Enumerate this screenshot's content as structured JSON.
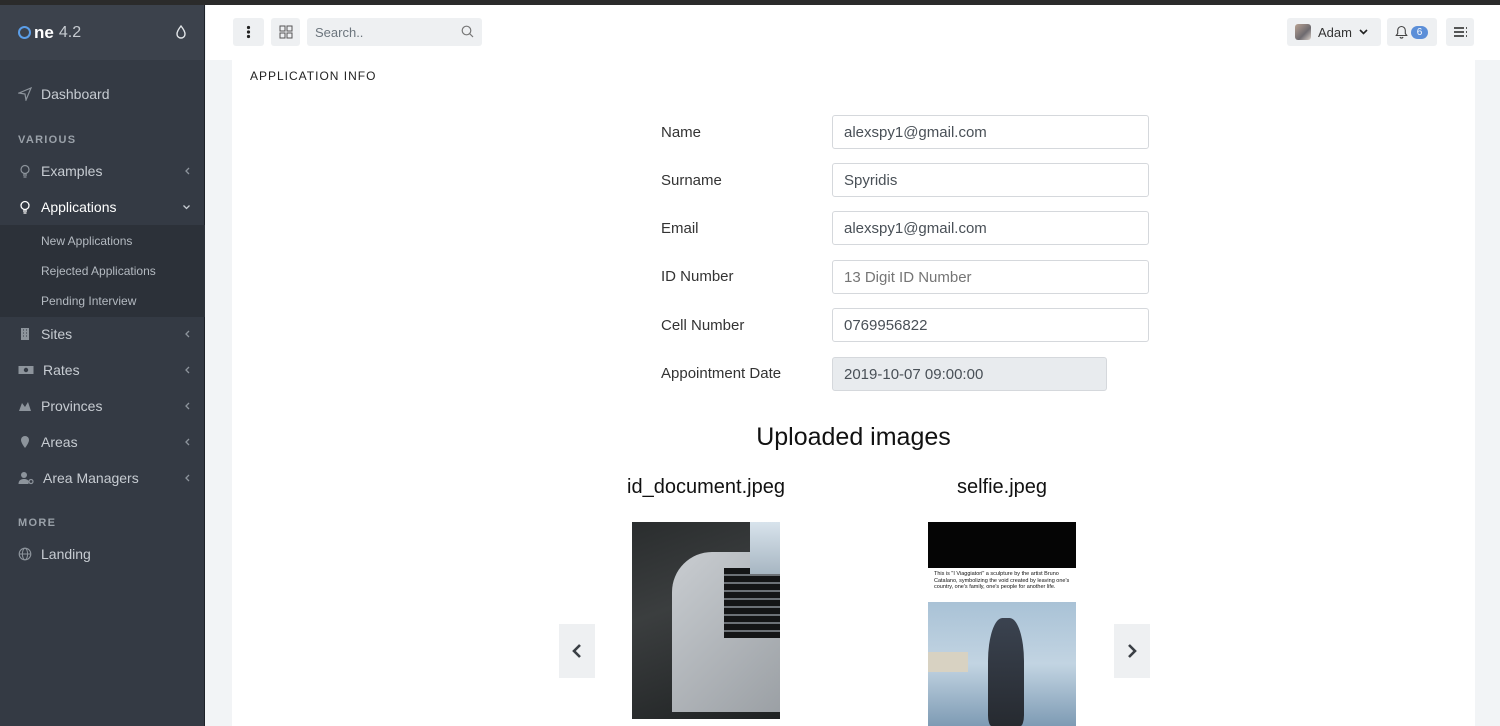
{
  "brand": {
    "name_bold": "ne",
    "version": "4.2"
  },
  "sidebar": {
    "dashboard": "Dashboard",
    "section_various": "VARIOUS",
    "examples": "Examples",
    "applications": "Applications",
    "sub_items": [
      "New Applications",
      "Rejected Applications",
      "Pending Interview"
    ],
    "sites": "Sites",
    "rates": "Rates",
    "provinces": "Provinces",
    "areas": "Areas",
    "area_managers": "Area Managers",
    "section_more": "MORE",
    "landing": "Landing"
  },
  "topbar": {
    "search_placeholder": "Search..",
    "user_name": "Adam",
    "notification_count": "6"
  },
  "card": {
    "title": "APPLICATION INFO",
    "fields": [
      {
        "label": "Name",
        "value": "alexspy1@gmail.com"
      },
      {
        "label": "Surname",
        "value": "Spyridis"
      },
      {
        "label": "Email",
        "value": "alexspy1@gmail.com"
      },
      {
        "label": "ID Number",
        "placeholder": "13 Digit ID Number"
      },
      {
        "label": "Cell Number",
        "value": "0769956822"
      },
      {
        "label": "Appointment Date",
        "value": "2019-10-07 09:00:00"
      }
    ],
    "uploads_heading": "Uploaded images",
    "images": [
      {
        "filename": "id_document.jpeg"
      },
      {
        "filename": "selfie.jpeg",
        "caption": "This is \"I Viaggiatori\" a sculpture by the artist Bruno Catalano, symbolizing the void created by leaving one's country, one's family, one's people for another life."
      }
    ]
  }
}
